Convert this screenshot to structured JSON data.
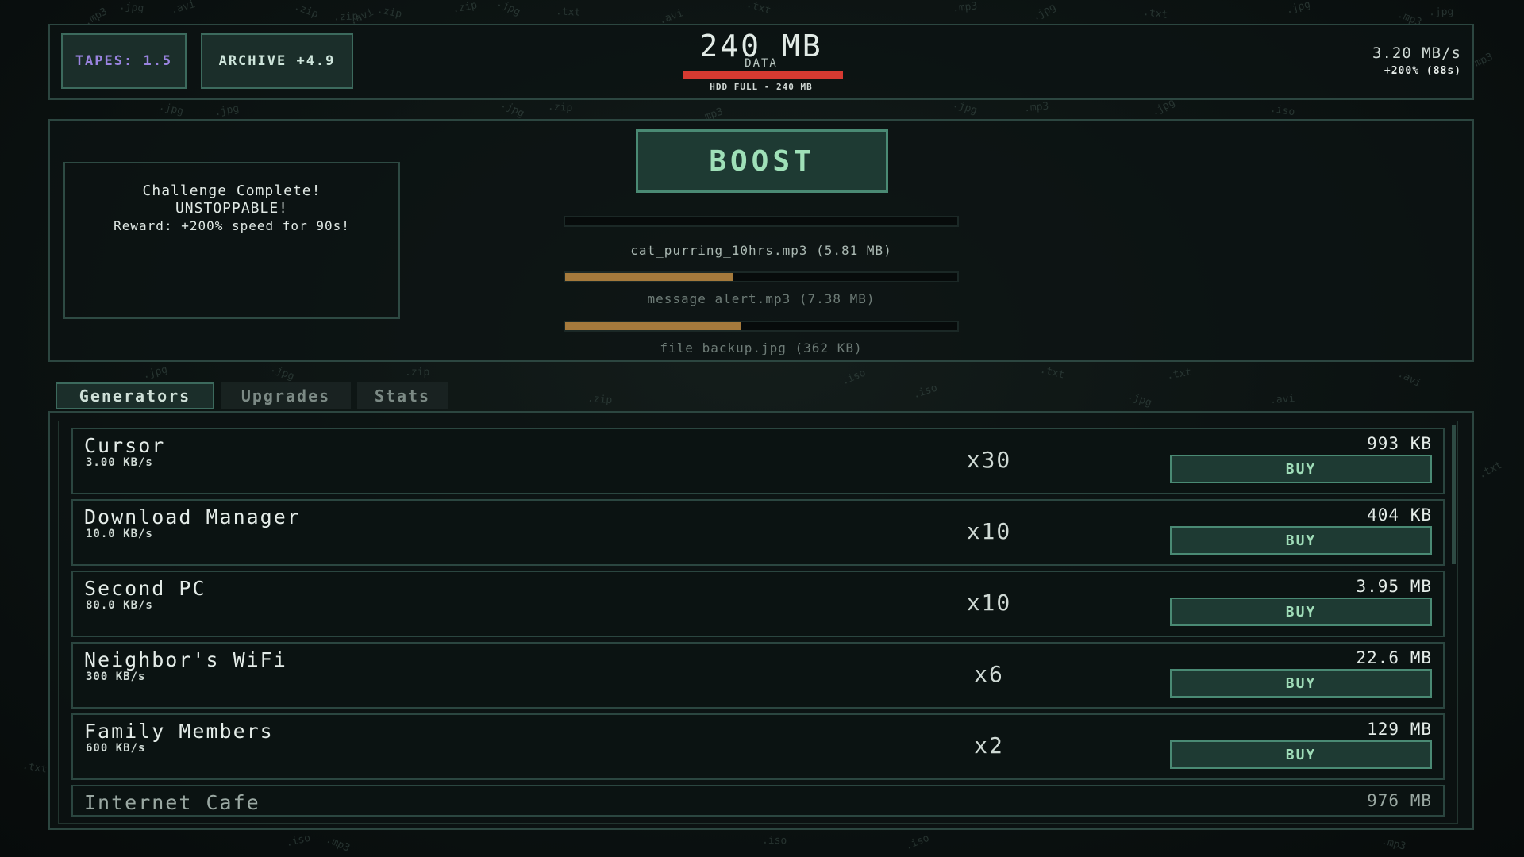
{
  "background_words": [
    {
      "text": ".mp3",
      "l": 105,
      "t": 14
    },
    {
      "text": ".jpg",
      "l": 150,
      "t": 2
    },
    {
      "text": ".avi",
      "l": 215,
      "t": 2
    },
    {
      "text": ".zip",
      "l": 370,
      "t": 6
    },
    {
      "text": ".zip",
      "l": 420,
      "t": 14
    },
    {
      "text": ".avi",
      "l": 440,
      "t": 14
    },
    {
      "text": ".zip",
      "l": 475,
      "t": 8
    },
    {
      "text": ".zip",
      "l": 570,
      "t": 2
    },
    {
      "text": ".jpg",
      "l": 625,
      "t": 2
    },
    {
      "text": ".txt",
      "l": 700,
      "t": 8
    },
    {
      "text": ".avi",
      "l": 830,
      "t": 14
    },
    {
      "text": ".txt",
      "l": 940,
      "t": 2
    },
    {
      "text": ".mp3",
      "l": 1200,
      "t": 2
    },
    {
      "text": ".jpg",
      "l": 1300,
      "t": 8
    },
    {
      "text": ".txt",
      "l": 1440,
      "t": 10
    },
    {
      "text": ".jpg",
      "l": 1620,
      "t": 2
    },
    {
      "text": ".mp3",
      "l": 1760,
      "t": 16
    },
    {
      "text": ".jpg",
      "l": 1800,
      "t": 8
    },
    {
      "text": ".mp3",
      "l": 1850,
      "t": 70
    },
    {
      "text": ".jpg",
      "l": 200,
      "t": 130
    },
    {
      "text": ".jpg",
      "l": 270,
      "t": 132
    },
    {
      "text": ".jpg",
      "l": 630,
      "t": 130
    },
    {
      "text": ".zip",
      "l": 690,
      "t": 128
    },
    {
      "text": ".mp3",
      "l": 880,
      "t": 138
    },
    {
      "text": ".jpg",
      "l": 1200,
      "t": 128
    },
    {
      "text": ".mp3",
      "l": 1290,
      "t": 128
    },
    {
      "text": ".jpg",
      "l": 1450,
      "t": 128
    },
    {
      "text": ".iso",
      "l": 1600,
      "t": 132
    },
    {
      "text": ".jpg",
      "l": 180,
      "t": 462
    },
    {
      "text": ".jpg",
      "l": 340,
      "t": 462
    },
    {
      "text": ".zip",
      "l": 510,
      "t": 462
    },
    {
      "text": ".iso",
      "l": 1060,
      "t": 468
    },
    {
      "text": ".txt",
      "l": 1310,
      "t": 462
    },
    {
      "text": ".txt",
      "l": 1470,
      "t": 464
    },
    {
      "text": ".avi",
      "l": 1760,
      "t": 470
    },
    {
      "text": ".zip",
      "l": 740,
      "t": 496
    },
    {
      "text": ".iso",
      "l": 1150,
      "t": 486
    },
    {
      "text": ".jpg",
      "l": 1420,
      "t": 496
    },
    {
      "text": ".avi",
      "l": 1600,
      "t": 496
    },
    {
      "text": ".txt",
      "l": 1862,
      "t": 585
    },
    {
      "text": ".txt",
      "l": 28,
      "t": 960
    },
    {
      "text": ".iso",
      "l": 360,
      "t": 1052
    },
    {
      "text": ".mp3",
      "l": 410,
      "t": 1056
    },
    {
      "text": ".iso",
      "l": 960,
      "t": 1052
    },
    {
      "text": ".iso",
      "l": 1140,
      "t": 1054
    },
    {
      "text": ".mp3",
      "l": 1740,
      "t": 1056
    }
  ],
  "header": {
    "tapes_label": "TAPES: 1.5",
    "archive_label": "ARCHIVE +4.9",
    "data_amount": "240 MB",
    "data_label": "DATA",
    "hdd_label": "HDD FULL - 240 MB",
    "rate": "3.20 MB/s",
    "rate_bonus": "+200% (88s)"
  },
  "challenge": {
    "line1": "Challenge Complete!",
    "line2": "UNSTOPPABLE!",
    "reward": "Reward: +200% speed for 90s!"
  },
  "boost_label": "BOOST",
  "downloads": [
    {
      "label": "cat_purring_10hrs.mp3 (5.81 MB)",
      "progress": 0.0,
      "dim": false
    },
    {
      "label": "message_alert.mp3 (7.38 MB)",
      "progress": 0.43,
      "dim": true
    },
    {
      "label": "file_backup.jpg (362 KB)",
      "progress": 0.45,
      "dim": true
    }
  ],
  "tabs": {
    "generators": "Generators",
    "upgrades": "Upgrades",
    "stats": "Stats"
  },
  "generators": [
    {
      "name": "Cursor",
      "rate": "3.00 KB/s",
      "count": "x30",
      "cost": "993 KB",
      "buy": "BUY"
    },
    {
      "name": "Download Manager",
      "rate": "10.0 KB/s",
      "count": "x10",
      "cost": "404 KB",
      "buy": "BUY"
    },
    {
      "name": "Second PC",
      "rate": "80.0 KB/s",
      "count": "x10",
      "cost": "3.95 MB",
      "buy": "BUY"
    },
    {
      "name": "Neighbor's WiFi",
      "rate": "300 KB/s",
      "count": "x6",
      "cost": "22.6 MB",
      "buy": "BUY"
    },
    {
      "name": "Family Members",
      "rate": "600 KB/s",
      "count": "x2",
      "cost": "129 MB",
      "buy": "BUY"
    },
    {
      "name": "Internet Cafe",
      "rate": "",
      "count": "",
      "cost": "976 MB",
      "buy": ""
    }
  ]
}
